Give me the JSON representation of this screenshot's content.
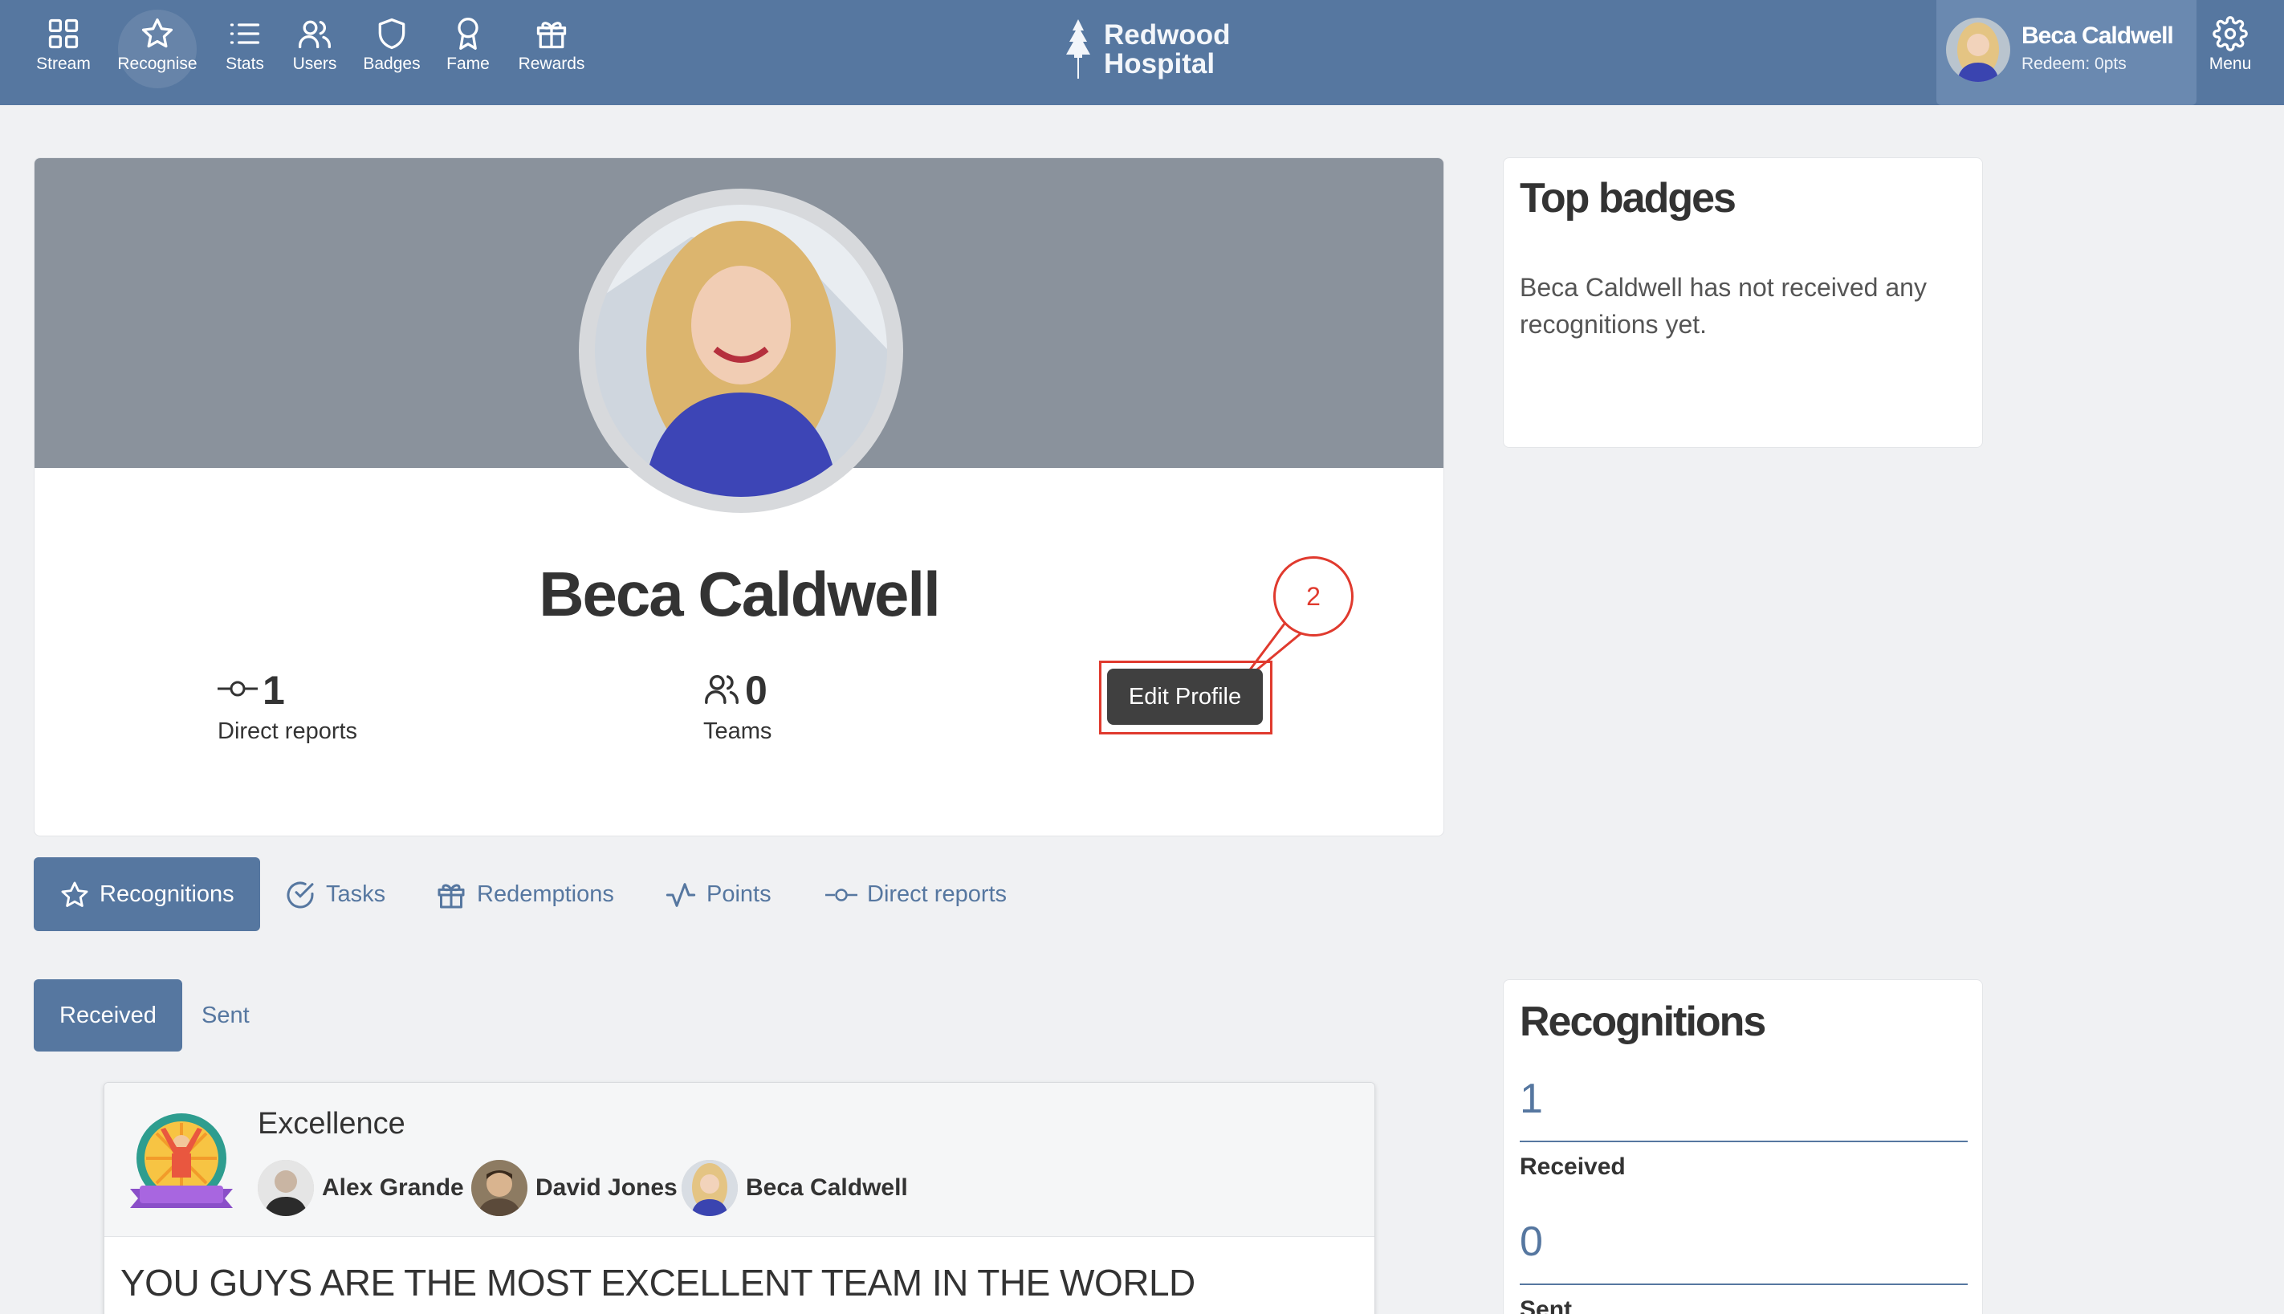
{
  "nav": {
    "items": [
      {
        "label": "Stream",
        "icon": "grid-icon"
      },
      {
        "label": "Recognise",
        "icon": "star-icon"
      },
      {
        "label": "Stats",
        "icon": "list-icon"
      },
      {
        "label": "Users",
        "icon": "users-icon"
      },
      {
        "label": "Badges",
        "icon": "shield-icon"
      },
      {
        "label": "Fame",
        "icon": "award-icon"
      },
      {
        "label": "Rewards",
        "icon": "gift-icon"
      }
    ],
    "brand_line1": "Redwood",
    "brand_line2": "Hospital",
    "user_name": "Beca Caldwell",
    "user_points": "Redeem: 0pts",
    "menu_label": "Menu"
  },
  "profile": {
    "name": "Beca Caldwell",
    "direct_reports_count": "1",
    "direct_reports_label": "Direct reports",
    "teams_count": "0",
    "teams_label": "Teams",
    "edit_label": "Edit Profile",
    "callout_number": "2"
  },
  "tabs": [
    {
      "label": "Recognitions",
      "icon": "star-icon"
    },
    {
      "label": "Tasks",
      "icon": "check-circle-icon"
    },
    {
      "label": "Redemptions",
      "icon": "gift-icon"
    },
    {
      "label": "Points",
      "icon": "activity-icon"
    },
    {
      "label": "Direct reports",
      "icon": "commit-icon"
    }
  ],
  "subtabs": {
    "received": "Received",
    "sent": "Sent"
  },
  "recognition": {
    "badge": "Excellence",
    "people": [
      "Alex Grande",
      "David Jones",
      "Beca Caldwell"
    ],
    "message": "YOU GUYS ARE THE MOST EXCELLENT TEAM IN THE WORLD"
  },
  "top_badges": {
    "title": "Top badges",
    "empty_text": "Beca Caldwell has not received any recognitions yet."
  },
  "recognitions_summary": {
    "title": "Recognitions",
    "received_count": "1",
    "received_label": "Received",
    "sent_count": "0",
    "sent_label": "Sent"
  },
  "colors": {
    "primary": "#5677a0",
    "highlight": "#e03a2e",
    "cover": "#8a929c"
  }
}
